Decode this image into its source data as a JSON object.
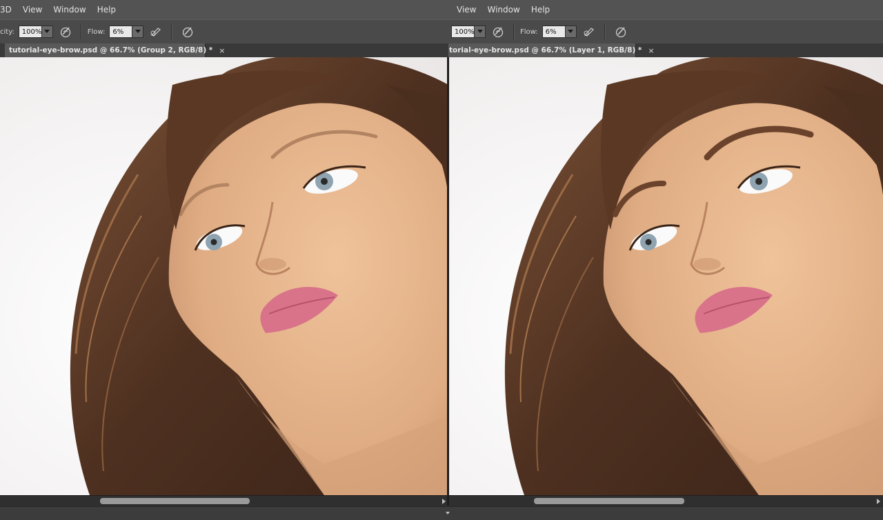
{
  "left": {
    "menu": [
      "3D",
      "View",
      "Window",
      "Help"
    ],
    "options": {
      "opacity_label": "city:",
      "opacity_value": "100%",
      "flow_label": "Flow:",
      "flow_value": "6%"
    },
    "tab": {
      "title": "tutorial-eye-brow.psd @ 66.7% (Group 2, RGB/8) *",
      "close": "×"
    }
  },
  "right": {
    "menu": [
      "View",
      "Window",
      "Help"
    ],
    "options": {
      "opacity_value": "100%",
      "flow_label": "Flow:",
      "flow_value": "6%"
    },
    "tab": {
      "title": "torial-eye-brow.psd @ 66.7% (Layer 1, RGB/8) *",
      "close": "×"
    }
  },
  "scrollbar": {
    "left_position": 0.28,
    "right_position": 0.3
  },
  "icons": [
    "airbrush-pressure-icon",
    "tablet-pressure-icon",
    "chevron-down-icon",
    "close-icon",
    "scroll-right-arrow-icon",
    "collapse-panel-icon"
  ],
  "colors": {
    "menubar": "#535353",
    "optionsbar": "#4a4a4a",
    "tab_active": "#5a5a5a",
    "field_bg": "#e9e9e9",
    "hair": "#5a3a22",
    "skin": "#e3b38a",
    "lips": "#d9738a",
    "eyes": "#8fa3b0",
    "background": "#f4f2f2"
  }
}
